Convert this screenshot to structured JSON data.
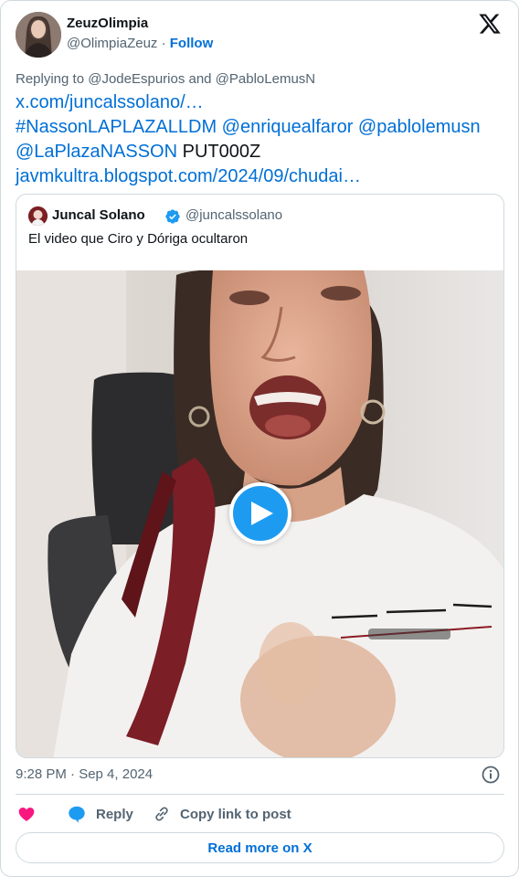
{
  "author": {
    "display_name": "ZeuzOlimpia",
    "handle": "@OlimpiaZeuz",
    "separator": "·",
    "follow_label": "Follow"
  },
  "reply_to": {
    "text": "Replying to @JodeEspurios and @PabloLemusN"
  },
  "tweet": {
    "line1": "x.com/juncalssolano/…",
    "line2": "#NassonLAPLAZALLDM @enriquealfaror @pablolemusn",
    "line3_mention": "@LaPlazaNASSON",
    "line3_text": " PUT000Z",
    "line4": "javmkultra.blogspot.com/2024/09/chudai…"
  },
  "quote": {
    "name": "Juncal Solano",
    "handle": "@juncalssolano",
    "text": "El video que Ciro y Dóriga ocultaron",
    "verified": true
  },
  "footer": {
    "timestamp": "9:28 PM · Sep 4, 2024",
    "reply_label": "Reply",
    "copy_label": "Copy link to post",
    "read_more_label": "Read more on X"
  },
  "colors": {
    "link": "#006fd6",
    "like": "#f91880",
    "play": "#1d9bf0",
    "verified": "#1d9bf0"
  },
  "icons": [
    "x-logo-icon",
    "verified-badge-icon",
    "play-icon",
    "info-icon",
    "heart-icon",
    "reply-bubble-icon",
    "link-icon"
  ]
}
